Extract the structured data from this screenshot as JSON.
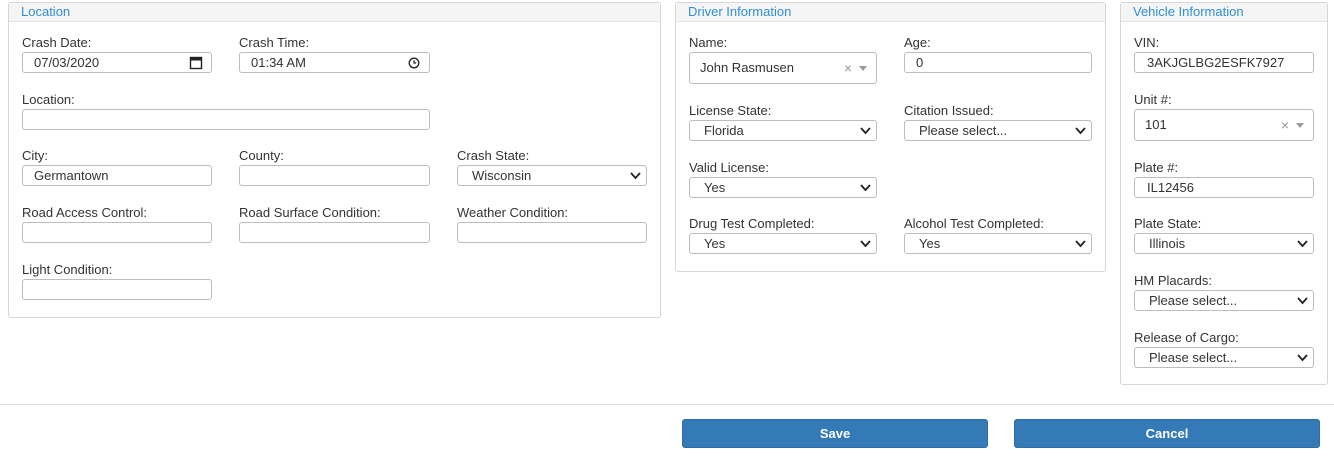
{
  "location": {
    "title": "Location",
    "crash_date_label": "Crash Date:",
    "crash_date_value": "07/03/2020",
    "crash_time_label": "Crash Time:",
    "crash_time_value": "01:34 AM",
    "location_label": "Location:",
    "location_value": "",
    "city_label": "City:",
    "city_value": "Germantown",
    "county_label": "County:",
    "county_value": "",
    "crash_state_label": "Crash State:",
    "crash_state_value": "Wisconsin",
    "road_access_label": "Road Access Control:",
    "road_access_value": "",
    "road_surface_label": "Road Surface Condition:",
    "road_surface_value": "",
    "weather_label": "Weather Condition:",
    "weather_value": "",
    "light_label": "Light Condition:",
    "light_value": ""
  },
  "driver": {
    "title": "Driver Information",
    "name_label": "Name:",
    "name_value": "John Rasmusen",
    "age_label": "Age:",
    "age_value": "0",
    "license_state_label": "License State:",
    "license_state_value": "Florida",
    "citation_label": "Citation Issued:",
    "citation_value": "Please select...",
    "valid_license_label": "Valid License:",
    "valid_license_value": "Yes",
    "drug_test_label": "Drug Test Completed:",
    "drug_test_value": "Yes",
    "alcohol_test_label": "Alcohol Test Completed:",
    "alcohol_test_value": "Yes"
  },
  "vehicle": {
    "title": "Vehicle Information",
    "vin_label": "VIN:",
    "vin_value": "3AKJGLBG2ESFK7927",
    "unit_label": "Unit #:",
    "unit_value": "101",
    "plate_label": "Plate #:",
    "plate_value": "IL12456",
    "plate_state_label": "Plate State:",
    "plate_state_value": "Illinois",
    "hm_placards_label": "HM Placards:",
    "hm_placards_value": "Please select...",
    "release_cargo_label": "Release of Cargo:",
    "release_cargo_value": "Please select..."
  },
  "actions": {
    "save_label": "Save",
    "cancel_label": "Cancel"
  },
  "icons": {
    "calendar": "calendar-icon",
    "clock": "clock-icon",
    "dropdown": "chevron-down-icon",
    "clear": "clear-icon"
  },
  "colors": {
    "accent": "#2e8fd5",
    "button": "#337ab7",
    "border": "#bdbdbd"
  }
}
